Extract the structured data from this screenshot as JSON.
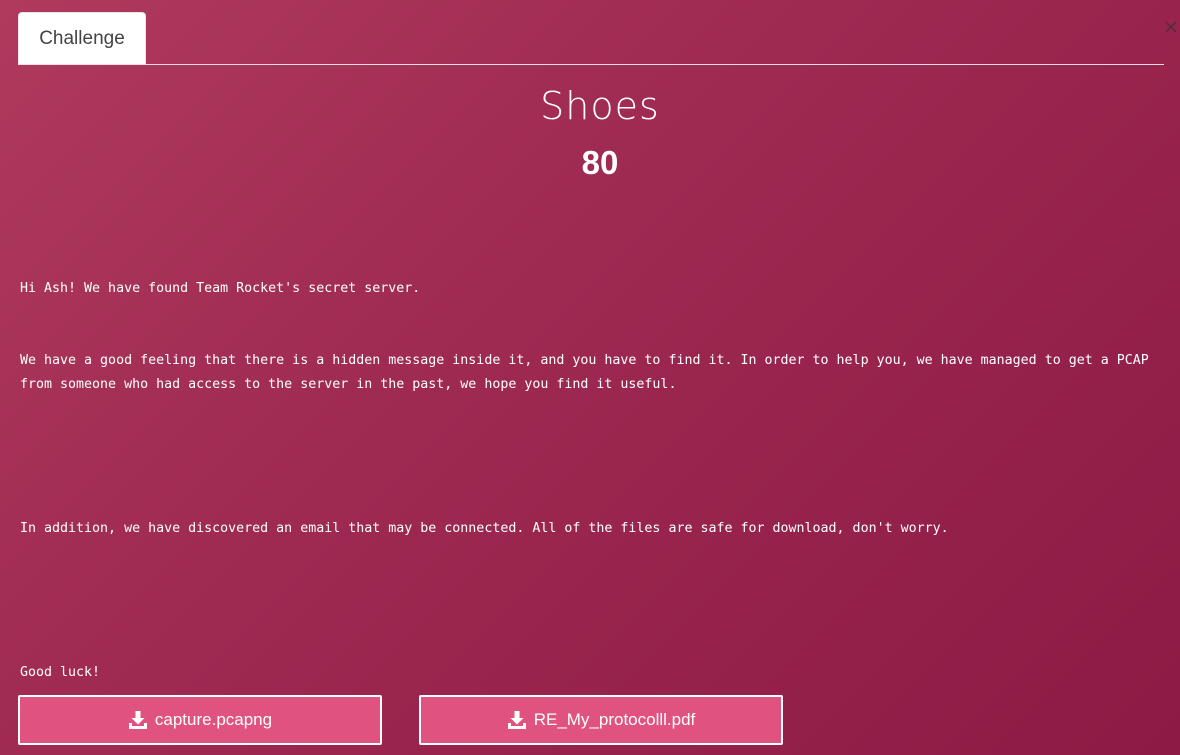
{
  "tabs": {
    "active_label": "Challenge"
  },
  "close_glyph": "×",
  "challenge": {
    "name": "Shoes",
    "points": "80",
    "description": {
      "line1": "Hi Ash! We have found Team Rocket's secret server.",
      "line2": "We have a good feeling that there is a hidden message inside it, and you have to find it. In order to help you, we have managed to get a PCAP from someone who had access to the server in the past, we hope you find it useful.",
      "line3": "In addition, we have discovered an email that may be connected. All of the files are safe for download, don't worry.",
      "line4": "Good luck!"
    }
  },
  "files": [
    {
      "name": "capture.pcapng",
      "icon": "download-icon"
    },
    {
      "name": "RE_My_protocolll.pdf",
      "icon": "download-icon"
    }
  ],
  "colors": {
    "background_start": "#b03a5e",
    "background_end": "#8c1a44",
    "download_button": "#e05380"
  }
}
